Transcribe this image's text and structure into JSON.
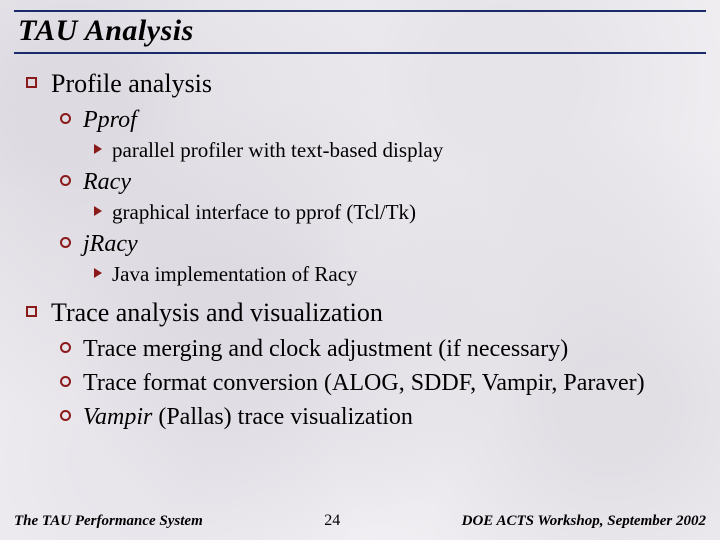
{
  "title": "TAU Analysis",
  "sections": [
    {
      "heading": "Profile analysis",
      "items": [
        {
          "name": "Pprof",
          "italic": true,
          "details": [
            "parallel profiler with text-based display"
          ]
        },
        {
          "name": "Racy",
          "italic": true,
          "details": [
            "graphical interface to pprof (Tcl/Tk)"
          ]
        },
        {
          "name": "jRacy",
          "italic": true,
          "details": [
            "Java implementation of Racy"
          ]
        }
      ]
    },
    {
      "heading": "Trace analysis and visualization",
      "items": [
        {
          "name": "Trace merging and clock adjustment (if necessary)",
          "italic": false,
          "details": []
        },
        {
          "name": "Trace format conversion (ALOG, SDDF, Vampir, Paraver)",
          "italic": false,
          "details": []
        },
        {
          "name_html": "<span class='ital'>Vampir</span> (Pallas) trace visualization",
          "italic": false,
          "details": []
        }
      ]
    }
  ],
  "footer": {
    "left": "The TAU Performance System",
    "page": "24",
    "right": "DOE ACTS Workshop, September 2002"
  }
}
